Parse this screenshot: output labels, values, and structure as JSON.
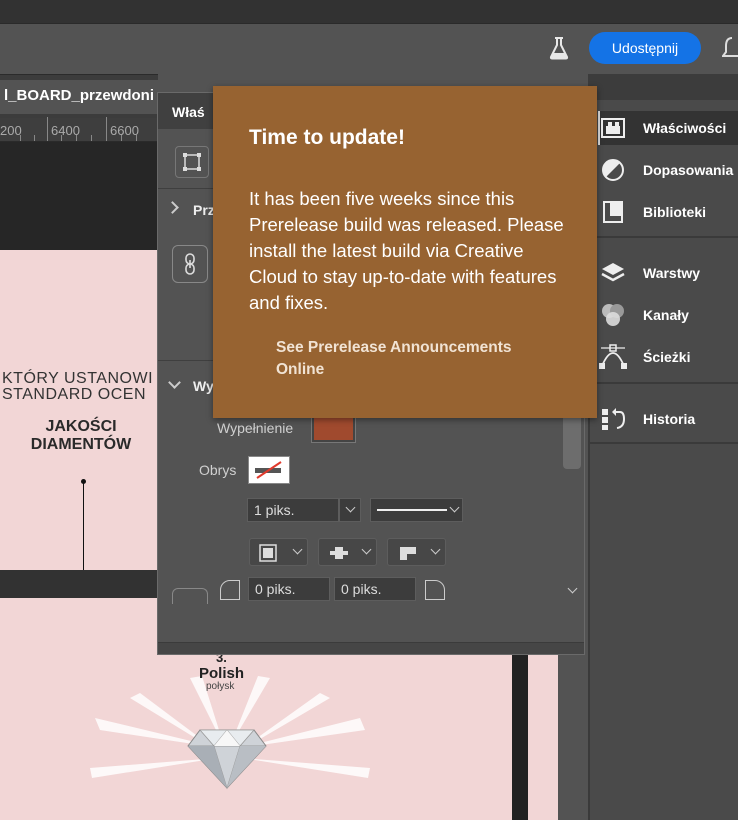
{
  "options_bar": {
    "share_label": "Udostępnij"
  },
  "document": {
    "tab_title": "l_BOARD_przewdoni",
    "ruler_labels": [
      "200",
      "6400",
      "6600"
    ]
  },
  "artboard": {
    "headline_line1": "KTÓRY USTANOWI",
    "headline_line2": "STANDARD OCEN",
    "bold_line": "JAKOŚCI\nDIAMENTÓW",
    "step_number": "3.",
    "step_title": "Polish",
    "step_subtitle": "połysk"
  },
  "properties_panel": {
    "title": "Właś",
    "section_transform": "Prz",
    "section_appearance": "Wy",
    "fill_label": "Wypełnienie",
    "stroke_label": "Obrys",
    "stroke_width": "1 piks.",
    "corner_radius_1": "0 piks.",
    "corner_radius_2": "0 piks.",
    "fill_color": "#a04a2e"
  },
  "right_panel": {
    "items": [
      {
        "label": "Właściwości",
        "icon": "properties-icon"
      },
      {
        "label": "Dopasowania",
        "icon": "adjustments-icon"
      },
      {
        "label": "Biblioteki",
        "icon": "libraries-icon"
      },
      {
        "label": "Warstwy",
        "icon": "layers-icon"
      },
      {
        "label": "Kanały",
        "icon": "channels-icon"
      },
      {
        "label": "Ścieżki",
        "icon": "paths-icon"
      },
      {
        "label": "Historia",
        "icon": "history-icon"
      }
    ]
  },
  "update_popover": {
    "title": "Time to update!",
    "body": "It has been five weeks since this Prerelease build was released. Please install the latest build via Creative Cloud to stay up-to-date with features and fixes.",
    "link": "See Prerelease Announcements Online",
    "background": "#976331"
  },
  "colors": {
    "accent": "#1473e6",
    "artboard_pink": "#f2d6d6"
  }
}
